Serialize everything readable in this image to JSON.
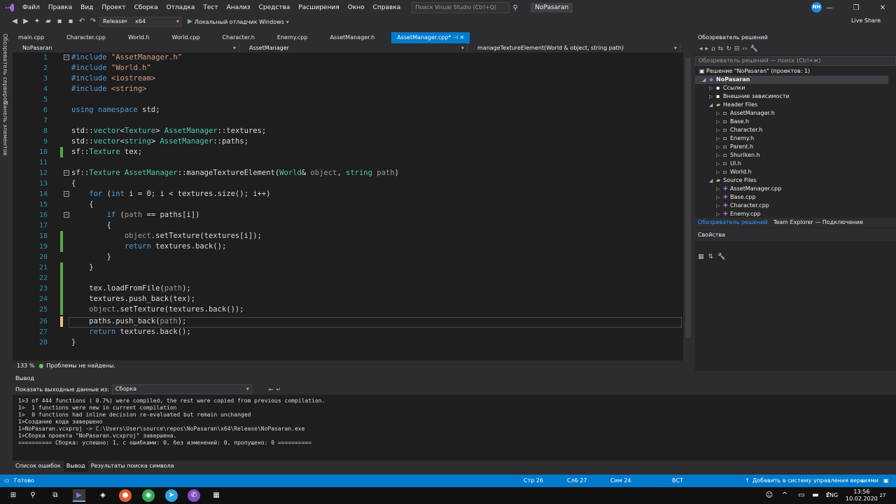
{
  "menu": {
    "items": [
      "Файл",
      "Правка",
      "Вид",
      "Проект",
      "Сборка",
      "Отладка",
      "Тест",
      "Анализ",
      "Средства",
      "Расширения",
      "Окно",
      "Справка"
    ],
    "search_placeholder": "Поиск Visual Studio (Ctrl+Q)",
    "solution_name": "NoPasaran",
    "user_initials": "NH"
  },
  "toolbar": {
    "config": "Release",
    "platform": "x64",
    "run_label": "Локальный отладчик Windows",
    "live_share": "Live Share"
  },
  "left_strip": {
    "server_explorer": "Обозреватель серверов",
    "toolbox": "Панель элементов"
  },
  "tabs": [
    "main.cpp",
    "Character.cpp",
    "World.h",
    "World.cpp",
    "Character.h",
    "Enemy.cpp",
    "AssetManager.h",
    "AssetManager.cpp*"
  ],
  "navbar": {
    "project": "NoPasaran",
    "scope": "AssetManager",
    "member": "manageTextureElement(World & object, string path)"
  },
  "editor": {
    "zoom": "133 %",
    "issues": "Проблемы не найдены."
  },
  "solution_explorer": {
    "title": "Обозреватель решений",
    "search_placeholder": "Обозреватель решений — поиск (Ctrl+ж)",
    "solution_label": "Решение \"NoPasaran\" (проектов: 1)",
    "project": "NoPasaran",
    "refs": "Ссылки",
    "ext_deps": "Внешние зависимости",
    "header_files": "Header Files",
    "headers": [
      "AssetManager.h",
      "Base.h",
      "Character.h",
      "Enemy.h",
      "Parent.h",
      "Shuriken.h",
      "UI.h",
      "World.h"
    ],
    "source_files": "Source Files",
    "sources": [
      "AssetManager.cpp",
      "Base.cpp",
      "Character.cpp",
      "Enemy.cpp"
    ],
    "tab_se": "Обозреватель решений",
    "tab_te": "Team Explorer — Подключение"
  },
  "properties": {
    "title": "Свойства"
  },
  "output": {
    "title": "Вывод",
    "show_from_label": "Показать выходные данные из:",
    "source": "Сборка",
    "lines": [
      "1>3 of 444 functions ( 0.7%) were compiled, the rest were copied from previous compilation.",
      "1>  1 functions were new in current compilation",
      "1>  0 functions had inline decision re-evaluated but remain unchanged",
      "1>Создание кода завершено",
      "1>NoPasaran.vcxproj -> C:\\Users\\User\\source\\repos\\NoPasaran\\x64\\Release\\NoPasaran.exe",
      "1>Сборка проекта \"NoPasaran.vcxproj\" завершена.",
      "========== Сборка: успешно: 1, с ошибками: 0, без изменений: 0, пропущено: 0 =========="
    ]
  },
  "bottom_tabs": [
    "Список ошибок",
    "Вывод",
    "Результаты поиска символа"
  ],
  "status": {
    "ready": "Готово",
    "line": "Стр 26",
    "col": "Сл6 27",
    "ch": "Сим 24",
    "mode": "ВСТ",
    "scm": "Добавить в систему управления версиями"
  },
  "taskbar": {
    "lang": "ENG",
    "time": "13:56",
    "date": "10.02.2020",
    "notif": "27"
  }
}
